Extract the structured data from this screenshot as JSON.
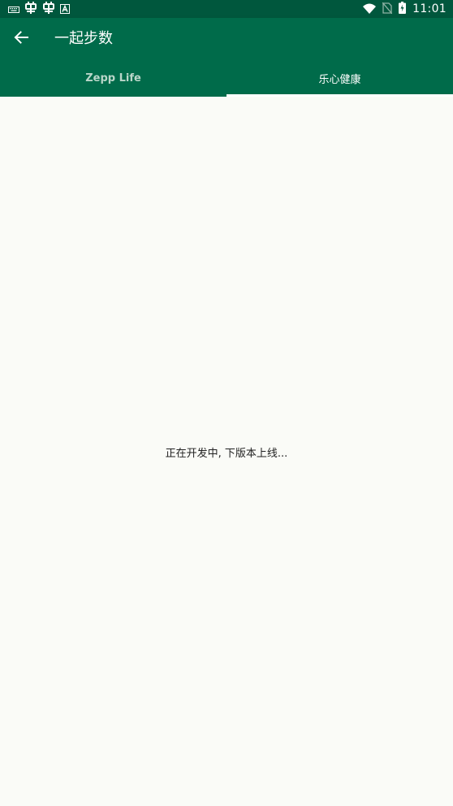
{
  "status_bar": {
    "time": "11:01",
    "colors": {
      "background": "#00573d"
    },
    "left_icons": [
      "keyboard-icon",
      "bug-icon",
      "bug-icon",
      "font-a-icon"
    ],
    "right_icons": [
      "wifi-icon",
      "no-sim-icon",
      "battery-charging-icon"
    ]
  },
  "toolbar": {
    "title": "一起步数",
    "back_icon": "arrow-left-icon",
    "colors": {
      "background": "#006b4a",
      "text": "#ffffff"
    }
  },
  "tabs": [
    {
      "label": "Zepp Life",
      "active": false
    },
    {
      "label": "乐心健康",
      "active": true
    }
  ],
  "content": {
    "message": "正在开发中, 下版本上线..."
  }
}
